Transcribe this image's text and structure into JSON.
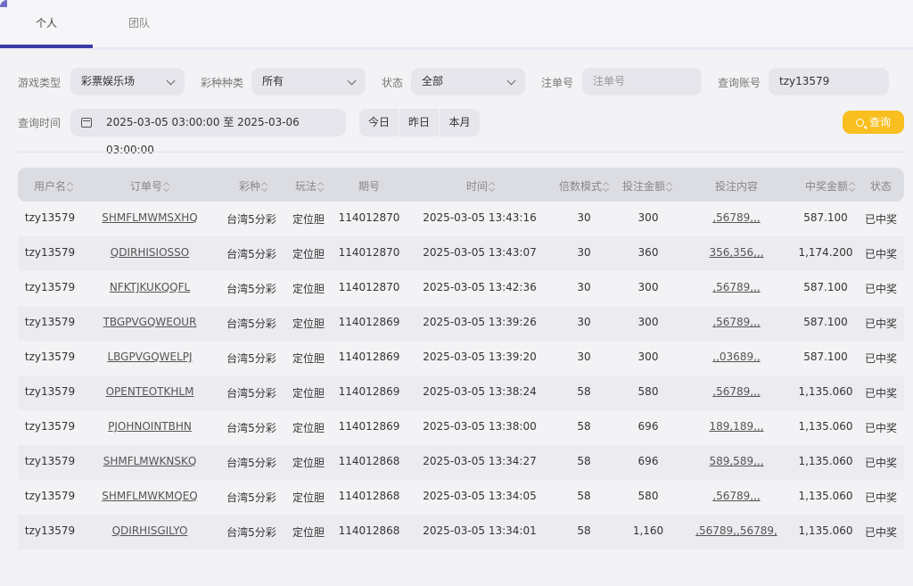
{
  "tabs": [
    {
      "label": "个人",
      "active": true
    },
    {
      "label": "团队",
      "active": false
    }
  ],
  "filters": {
    "game_type": {
      "label": "游戏类型",
      "value": "彩票娱乐场"
    },
    "lottery_kind": {
      "label": "彩种种类",
      "value": "所有"
    },
    "status": {
      "label": "状态",
      "value": "全部"
    },
    "order_no": {
      "label": "注单号",
      "placeholder": "注单号"
    },
    "account": {
      "label": "查询账号",
      "value": "tzy13579"
    },
    "time": {
      "label": "查询时间",
      "value": "2025-03-05 03:00:00 至 2025-03-06 03:00:00"
    },
    "quick_dates": [
      "今日",
      "昨日",
      "本月"
    ],
    "search_label": "查询"
  },
  "table": {
    "headers": [
      "用户名",
      "订单号",
      "彩种",
      "玩法",
      "期号",
      "时间",
      "倍数模式",
      "投注金额",
      "投注内容",
      "中奖金额",
      "状态"
    ],
    "rows": [
      [
        "tzy13579",
        "SHMFLMWMSXHQ",
        "台湾5分彩",
        "定位胆",
        "114012870",
        "2025-03-05 13:43:16",
        "30",
        "300",
        ",56789,,,",
        "587.100",
        "已中奖"
      ],
      [
        "tzy13579",
        "QDIRHISIOSSO",
        "台湾5分彩",
        "定位胆",
        "114012870",
        "2025-03-05 13:43:07",
        "30",
        "360",
        "356,356,,,",
        "1,174.200",
        "已中奖"
      ],
      [
        "tzy13579",
        "NFKTJKUKQQFL",
        "台湾5分彩",
        "定位胆",
        "114012870",
        "2025-03-05 13:42:36",
        "30",
        "300",
        ",56789,,,",
        "587.100",
        "已中奖"
      ],
      [
        "tzy13579",
        "TBGPVGQWEOUR",
        "台湾5分彩",
        "定位胆",
        "114012869",
        "2025-03-05 13:39:26",
        "30",
        "300",
        ",56789,,,",
        "587.100",
        "已中奖"
      ],
      [
        "tzy13579",
        "LBGPVGQWELPJ",
        "台湾5分彩",
        "定位胆",
        "114012869",
        "2025-03-05 13:39:20",
        "30",
        "300",
        ",,03689,,",
        "587.100",
        "已中奖"
      ],
      [
        "tzy13579",
        "OPENTEOTKHLM",
        "台湾5分彩",
        "定位胆",
        "114012869",
        "2025-03-05 13:38:24",
        "58",
        "580",
        ",56789,,,",
        "1,135.060",
        "已中奖"
      ],
      [
        "tzy13579",
        "PJOHNOINTBHN",
        "台湾5分彩",
        "定位胆",
        "114012869",
        "2025-03-05 13:38:00",
        "58",
        "696",
        "189,189,,,",
        "1,135.060",
        "已中奖"
      ],
      [
        "tzy13579",
        "SHMFLMWKNSKQ",
        "台湾5分彩",
        "定位胆",
        "114012868",
        "2025-03-05 13:34:27",
        "58",
        "696",
        "589,589,,,",
        "1,135.060",
        "已中奖"
      ],
      [
        "tzy13579",
        "SHMFLMWKMQEQ",
        "台湾5分彩",
        "定位胆",
        "114012868",
        "2025-03-05 13:34:05",
        "58",
        "580",
        ",56789,,,",
        "1,135.060",
        "已中奖"
      ],
      [
        "tzy13579",
        "QDIRHISGILYO",
        "台湾5分彩",
        "定位胆",
        "114012868",
        "2025-03-05 13:34:01",
        "58",
        "1,160",
        ",56789,,56789,",
        "1,135.060",
        "已中奖"
      ]
    ]
  }
}
